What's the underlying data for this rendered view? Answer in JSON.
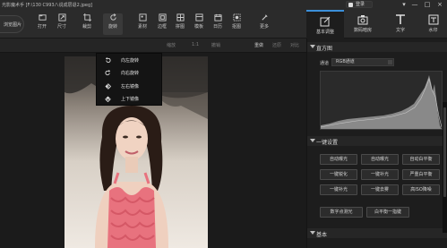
{
  "titlebar": {
    "title": "光影魔术手 [F:\\130 C993八说成层退2.jpeg]",
    "login_label": "登录",
    "controls": [
      "▾",
      "—",
      "□",
      "×"
    ]
  },
  "toolbar": {
    "open_label": "浏览图片",
    "tools": [
      {
        "label": "打开",
        "icon": "open-icon"
      },
      {
        "label": "尺寸",
        "icon": "resize-icon"
      },
      {
        "label": "裁剪",
        "icon": "crop-icon"
      },
      {
        "label": "旋转",
        "icon": "rotate-icon"
      },
      {
        "label": "素材",
        "icon": "material-icon"
      },
      {
        "label": "边框",
        "icon": "border-icon"
      },
      {
        "label": "拼图",
        "icon": "collage-icon"
      },
      {
        "label": "模板",
        "icon": "template-icon"
      },
      {
        "label": "日历",
        "icon": "calendar-icon"
      },
      {
        "label": "抠图",
        "icon": "cutout-icon"
      },
      {
        "label": "更多",
        "icon": "more-icon"
      }
    ]
  },
  "subbar": {
    "items": [
      "缩放",
      "1:1",
      "撤销",
      "重做",
      "还原",
      "对比"
    ]
  },
  "rotate_menu": {
    "items": [
      {
        "label": "向左旋转",
        "icon": "rotate-left-icon"
      },
      {
        "label": "向右旋转",
        "icon": "rotate-right-icon"
      },
      {
        "label": "左右镜像",
        "icon": "mirror-horizontal-icon"
      },
      {
        "label": "上下镜像",
        "icon": "mirror-vertical-icon"
      }
    ]
  },
  "right_tabs": [
    {
      "label": "基本调整",
      "icon": "basic-adjust-icon",
      "active": true
    },
    {
      "label": "数码暗房",
      "icon": "darkroom-icon",
      "active": false
    },
    {
      "label": "文字",
      "icon": "text-icon",
      "active": false
    },
    {
      "label": "水印",
      "icon": "watermark-icon",
      "active": false
    }
  ],
  "panel": {
    "histogram_title": "直方图",
    "channel_label": "通道",
    "channel_value": "RGB通道",
    "one_click_title": "一键设置",
    "buttons": [
      [
        "自动曝光",
        "自动曝光",
        "自动白平衡"
      ],
      [
        "一键锐化",
        "一键补光",
        "严重白平衡"
      ],
      [
        "一键补光",
        "一键去雾",
        "高ISO降噪"
      ],
      [
        "数字点测光",
        "白平衡一指键"
      ]
    ],
    "basic_title": "基本"
  },
  "colors": {
    "accent": "#3b8fd9",
    "background": "#1c1c1c",
    "panel": "#1d1d1d"
  }
}
